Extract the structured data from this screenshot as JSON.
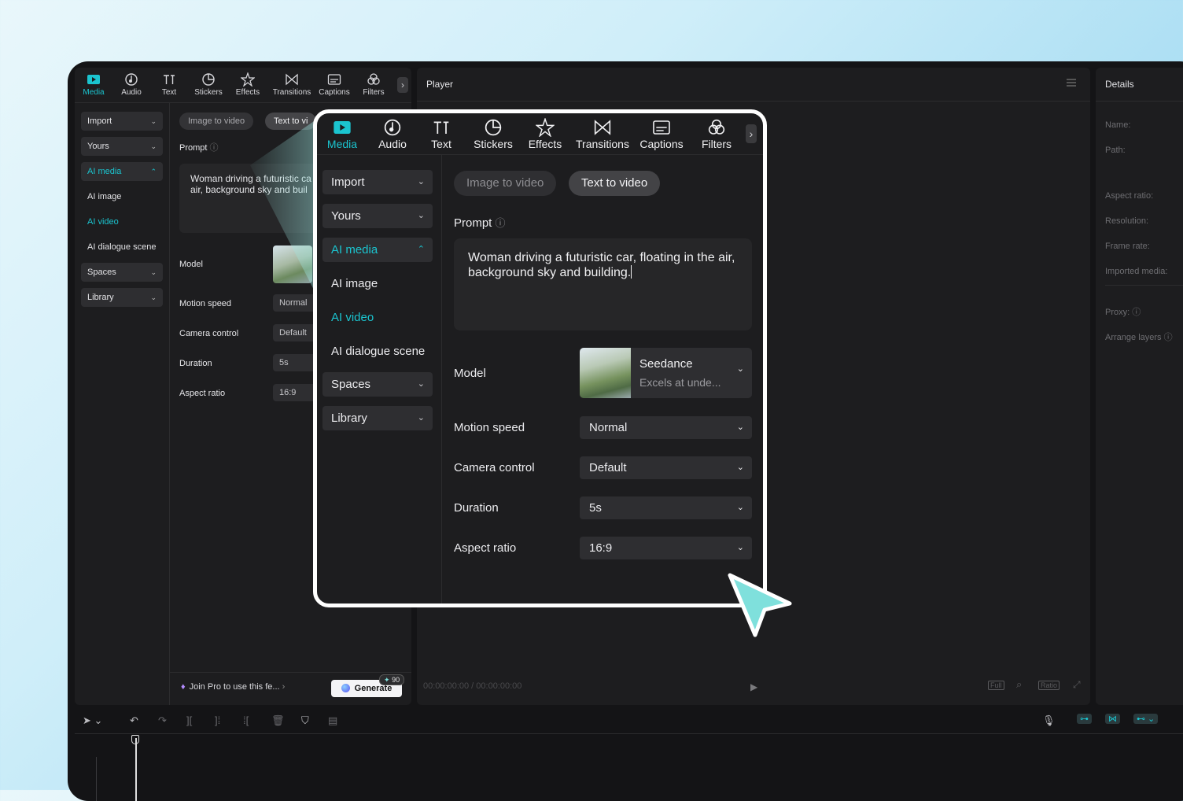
{
  "tabs": [
    {
      "label": "Media",
      "icon": "media-icon",
      "active": true
    },
    {
      "label": "Audio",
      "icon": "audio-icon"
    },
    {
      "label": "Text",
      "icon": "text-icon"
    },
    {
      "label": "Stickers",
      "icon": "stickers-icon"
    },
    {
      "label": "Effects",
      "icon": "effects-icon"
    },
    {
      "label": "Transitions",
      "icon": "transitions-icon"
    },
    {
      "label": "Captions",
      "icon": "captions-icon"
    },
    {
      "label": "Filters",
      "icon": "filters-icon"
    }
  ],
  "sidebar": {
    "import": "Import",
    "yours": "Yours",
    "ai_media": "AI media",
    "ai_image": "AI image",
    "ai_video": "AI video",
    "ai_dialogue": "AI dialogue scene",
    "spaces": "Spaces",
    "library": "Library"
  },
  "mode_tabs": {
    "image_to_video": "Image to video",
    "text_to_video": "Text to video",
    "text_to_video_short": "Text to vi",
    "selected": "text_to_video"
  },
  "prompt": {
    "label": "Prompt",
    "value": "Woman driving a futuristic car, floating in the air, background sky and building.",
    "value_short_line1": "Woman driving a futuristic ca",
    "value_short_line2": "air, background sky and buil"
  },
  "model": {
    "label": "Model",
    "name": "Seedance",
    "description": "Excels at unde..."
  },
  "motion_speed": {
    "label": "Motion speed",
    "value": "Normal"
  },
  "camera_control": {
    "label": "Camera control",
    "value": "Default"
  },
  "duration": {
    "label": "Duration",
    "value": "5s"
  },
  "aspect_ratio": {
    "label": "Aspect ratio",
    "value": "16:9"
  },
  "footer": {
    "join_pro": "Join Pro to use this fe...",
    "generate": "Generate",
    "credits": "90"
  },
  "player": {
    "title": "Player",
    "timecode": "00:00:00:00 / 00:00:00:00",
    "full": "Full",
    "ratio": "Ratio"
  },
  "details": {
    "title": "Details",
    "fields": [
      "Name:",
      "Path:",
      "Aspect ratio:",
      "Resolution:",
      "Frame rate:",
      "Imported media:"
    ],
    "proxy": "Proxy:",
    "arrange_layers": "Arrange layers"
  },
  "colors": {
    "accent": "#1bc4cf",
    "panel": "#1d1d1f",
    "app_bg": "#141416",
    "arrow": "#7fe0dc"
  }
}
